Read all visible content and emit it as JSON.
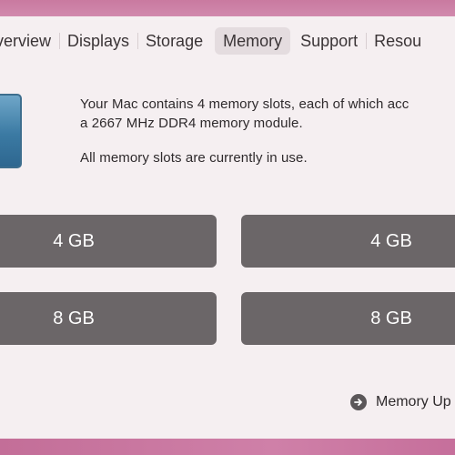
{
  "tabs": [
    {
      "label": "verview",
      "active": false
    },
    {
      "label": "Displays",
      "active": false
    },
    {
      "label": "Storage",
      "active": false
    },
    {
      "label": "Memory",
      "active": true
    },
    {
      "label": "Support",
      "active": false
    },
    {
      "label": "Resou",
      "active": false
    }
  ],
  "memory": {
    "description_line1": "Your Mac contains 4 memory slots, each of which acc",
    "description_line2": "a 2667 MHz DDR4 memory module.",
    "status": "All memory slots are currently in use.",
    "slots": [
      {
        "size": "4 GB"
      },
      {
        "size": "4 GB"
      },
      {
        "size": "8 GB"
      },
      {
        "size": "8 GB"
      }
    ],
    "upgrade_label": "Memory Up"
  },
  "colors": {
    "accent_icon": "#3b7aa3",
    "slot_fill": "#6b6668",
    "desktop": "#c9749c"
  }
}
